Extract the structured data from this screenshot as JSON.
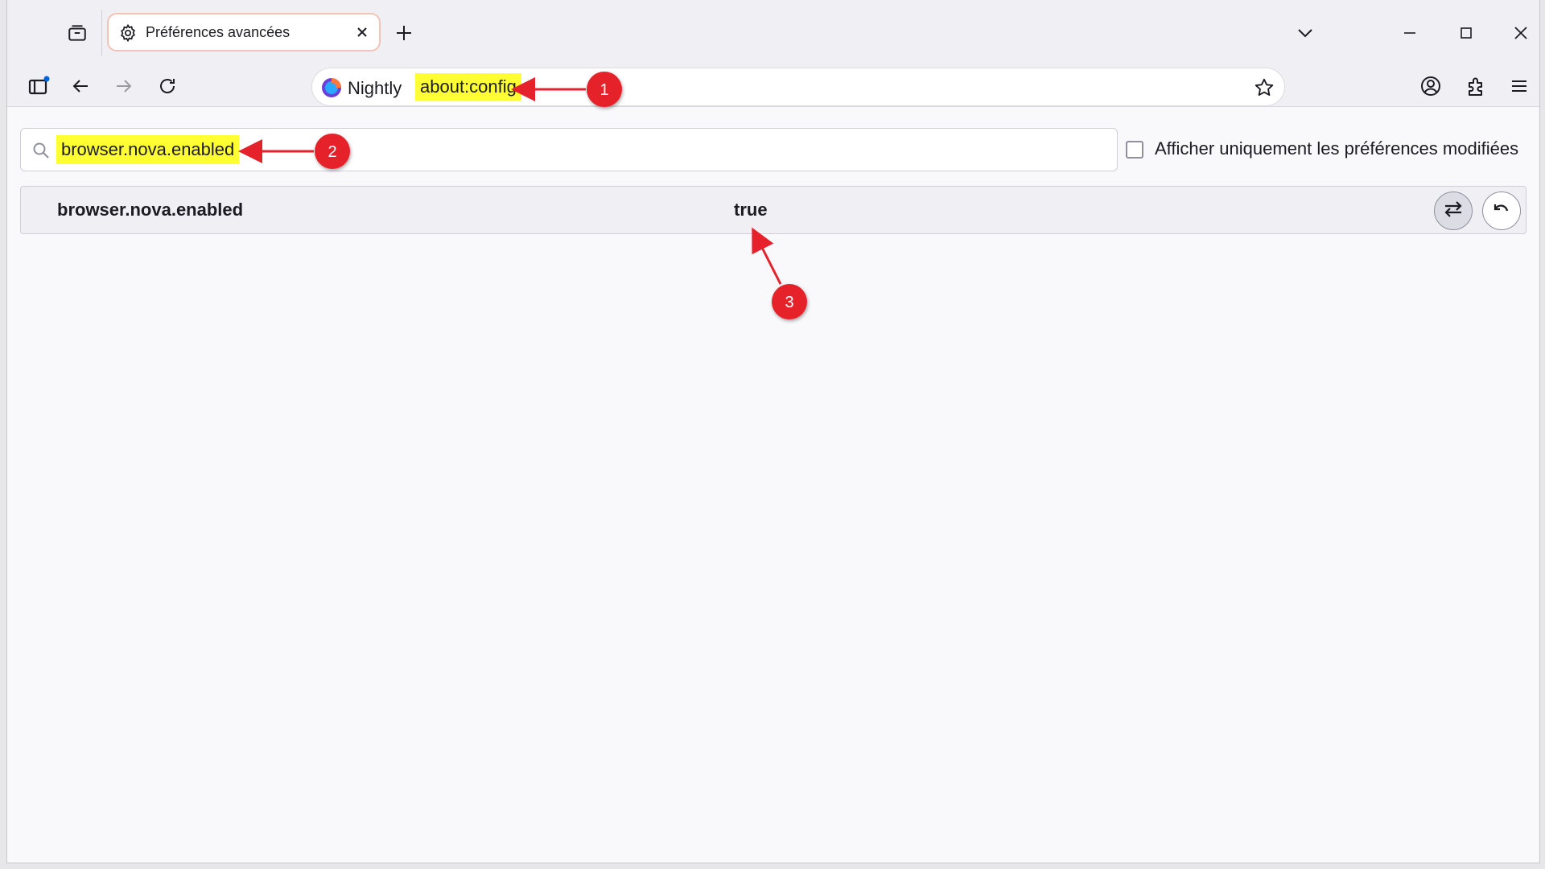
{
  "tab": {
    "title": "Préférences avancées"
  },
  "urlbar": {
    "identity_label": "Nightly",
    "url": "about:config"
  },
  "search": {
    "value": "browser.nova.enabled"
  },
  "filter": {
    "label": "Afficher uniquement les préférences modifiées",
    "checked": false
  },
  "preferences": [
    {
      "name": "browser.nova.enabled",
      "value": "true"
    }
  ],
  "annotations": [
    {
      "label": "1"
    },
    {
      "label": "2"
    },
    {
      "label": "3"
    }
  ],
  "colors": {
    "highlight": "#ffff33",
    "annotation": "#e5212b",
    "tab_border": "#f3c3b8"
  }
}
